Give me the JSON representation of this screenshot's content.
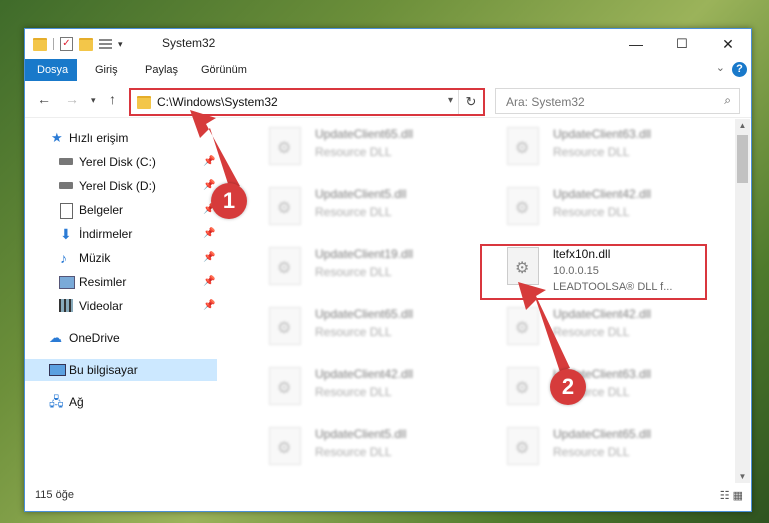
{
  "window": {
    "title": "System32",
    "controls": {
      "minimize": "—",
      "maximize": "☐",
      "close": "✕"
    }
  },
  "ribbon": {
    "tabs": [
      "Dosya",
      "Giriş",
      "Paylaş",
      "Görünüm"
    ],
    "help": "?",
    "collapse": "⌄"
  },
  "address": {
    "path": "C:\\Windows\\System32",
    "search_placeholder": "Ara: System32"
  },
  "nav": {
    "items": [
      {
        "label": "Hızlı erişim",
        "icon": "star-icon"
      },
      {
        "label": "Yerel Disk (C:)",
        "icon": "drive-icon",
        "pinned": true
      },
      {
        "label": "Yerel Disk (D:)",
        "icon": "drive-icon",
        "pinned": true
      },
      {
        "label": "Belgeler",
        "icon": "documents-icon",
        "pinned": true
      },
      {
        "label": "İndirmeler",
        "icon": "download-icon",
        "pinned": true
      },
      {
        "label": "Müzik",
        "icon": "music-icon",
        "pinned": true
      },
      {
        "label": "Resimler",
        "icon": "pictures-icon",
        "pinned": true
      },
      {
        "label": "Videolar",
        "icon": "video-icon",
        "pinned": true
      },
      {
        "label": "OneDrive",
        "icon": "cloud-icon"
      },
      {
        "label": "Bu bilgisayar",
        "icon": "computer-icon",
        "selected": true
      },
      {
        "label": "Ağ",
        "icon": "network-icon"
      }
    ]
  },
  "files": [
    {
      "name": "UpdateClient65.dll",
      "desc": "Resource DLL"
    },
    {
      "name": "UpdateClient63.dll",
      "desc": "Resource DLL"
    },
    {
      "name": "UpdateClient5.dll",
      "desc": "Resource DLL"
    },
    {
      "name": "UpdateClient42.dll",
      "desc": "Resource DLL"
    },
    {
      "name": "UpdateClient19.dll",
      "desc": "Resource DLL"
    },
    {
      "name": "ltefx10n.dll",
      "desc": "10.0.0.15",
      "desc2": "LEADTOOLSA® DLL f..."
    },
    {
      "name": "UpdateClient65.dll",
      "desc": "Resource DLL"
    },
    {
      "name": "UpdateClient42.dll",
      "desc": "Resource DLL"
    },
    {
      "name": "UpdateClient42.dll",
      "desc": "Resource DLL"
    },
    {
      "name": "UpdateClient63.dll",
      "desc": "Resource DLL"
    },
    {
      "name": "UpdateClient5.dll",
      "desc": "Resource DLL"
    },
    {
      "name": "UpdateClient65.dll",
      "desc": "Resource DLL"
    }
  ],
  "status": {
    "count": "115 öğe"
  },
  "annotations": {
    "marker1": "1",
    "marker2": "2",
    "color": "#d63b3b"
  }
}
